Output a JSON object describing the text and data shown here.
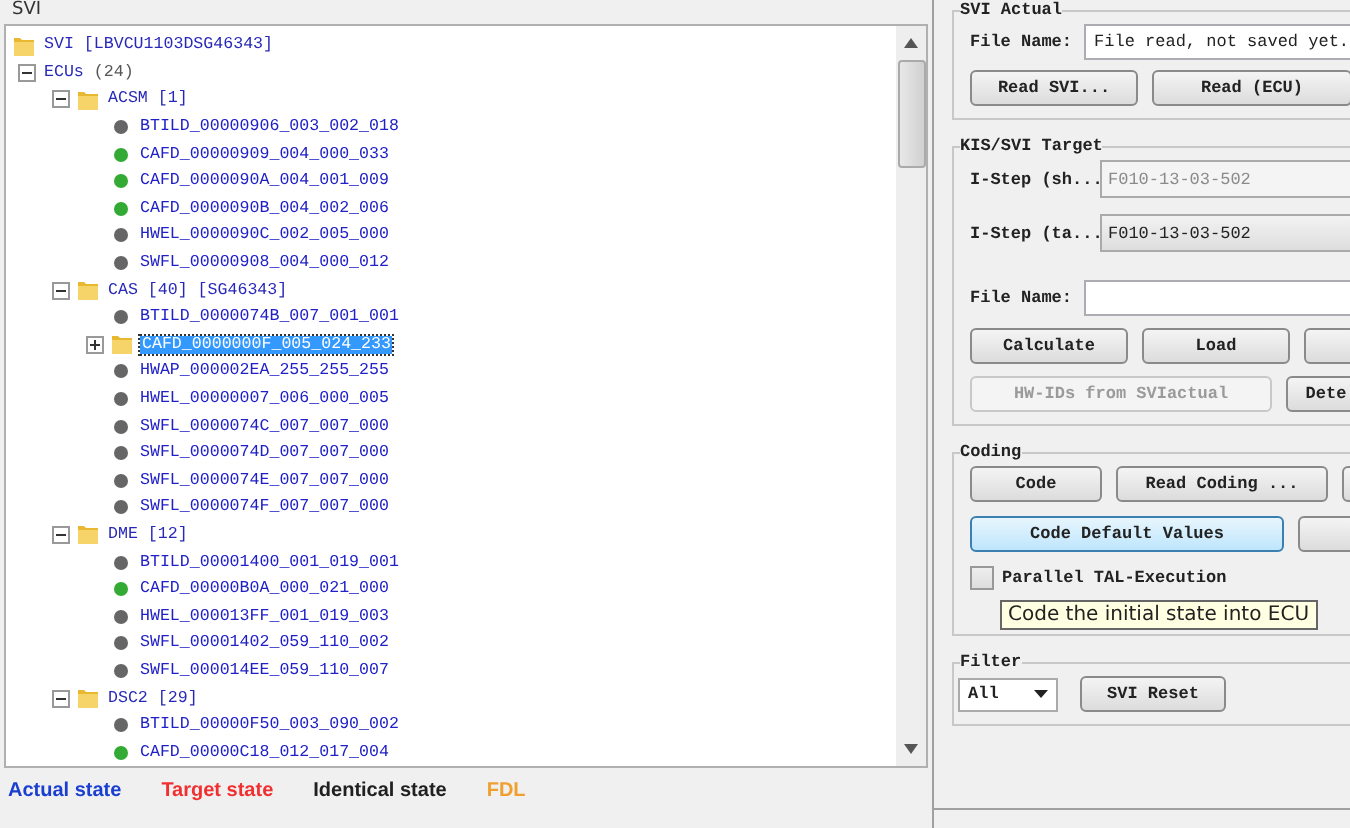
{
  "left_panel": {
    "title": "SVI",
    "tree": {
      "label": "SVI [LBVCU1103DSG46343]",
      "kind": "root",
      "selected": false,
      "children": [
        {
          "label": "ECUs",
          "count": "(24)",
          "kind": "group",
          "expanded": true,
          "selected": false,
          "children": [
            {
              "label": "ACSM [1]",
              "kind": "folder",
              "expanded": true,
              "selected": false,
              "children": [
                {
                  "label": "BTILD_00000906_003_002_018",
                  "kind": "unit",
                  "color": "#666666",
                  "selected": false
                },
                {
                  "label": "CAFD_00000909_004_000_033",
                  "kind": "unit",
                  "color": "#33aa33",
                  "selected": false
                },
                {
                  "label": "CAFD_0000090A_004_001_009",
                  "kind": "unit",
                  "color": "#33aa33",
                  "selected": false
                },
                {
                  "label": "CAFD_0000090B_004_002_006",
                  "kind": "unit",
                  "color": "#33aa33",
                  "selected": false
                },
                {
                  "label": "HWEL_0000090C_002_005_000",
                  "kind": "unit",
                  "color": "#666666",
                  "selected": false
                },
                {
                  "label": "SWFL_00000908_004_000_012",
                  "kind": "unit",
                  "color": "#666666",
                  "selected": false
                }
              ]
            },
            {
              "label": "CAS [40] [SG46343]",
              "kind": "folder",
              "expanded": true,
              "selected": false,
              "children": [
                {
                  "label": "BTILD_0000074B_007_001_001",
                  "kind": "unit",
                  "color": "#666666",
                  "selected": false
                },
                {
                  "label": "CAFD_0000000F_005_024_233",
                  "kind": "folder",
                  "expanded": false,
                  "selected": true
                },
                {
                  "label": "HWAP_000002EA_255_255_255",
                  "kind": "unit",
                  "color": "#666666",
                  "selected": false
                },
                {
                  "label": "HWEL_00000007_006_000_005",
                  "kind": "unit",
                  "color": "#666666",
                  "selected": false
                },
                {
                  "label": "SWFL_0000074C_007_007_000",
                  "kind": "unit",
                  "color": "#666666",
                  "selected": false
                },
                {
                  "label": "SWFL_0000074D_007_007_000",
                  "kind": "unit",
                  "color": "#666666",
                  "selected": false
                },
                {
                  "label": "SWFL_0000074E_007_007_000",
                  "kind": "unit",
                  "color": "#666666",
                  "selected": false
                },
                {
                  "label": "SWFL_0000074F_007_007_000",
                  "kind": "unit",
                  "color": "#666666",
                  "selected": false
                }
              ]
            },
            {
              "label": "DME [12]",
              "kind": "folder",
              "expanded": true,
              "selected": false,
              "children": [
                {
                  "label": "BTILD_00001400_001_019_001",
                  "kind": "unit",
                  "color": "#666666",
                  "selected": false
                },
                {
                  "label": "CAFD_00000B0A_000_021_000",
                  "kind": "unit",
                  "color": "#33aa33",
                  "selected": false
                },
                {
                  "label": "HWEL_000013FF_001_019_003",
                  "kind": "unit",
                  "color": "#666666",
                  "selected": false
                },
                {
                  "label": "SWFL_00001402_059_110_002",
                  "kind": "unit",
                  "color": "#666666",
                  "selected": false
                },
                {
                  "label": "SWFL_000014EE_059_110_007",
                  "kind": "unit",
                  "color": "#666666",
                  "selected": false
                }
              ]
            },
            {
              "label": "DSC2 [29]",
              "kind": "folder",
              "expanded": true,
              "selected": false,
              "children": [
                {
                  "label": "BTILD_00000F50_003_090_002",
                  "kind": "unit",
                  "color": "#666666",
                  "selected": false
                },
                {
                  "label": "CAFD_00000C18_012_017_004",
                  "kind": "unit",
                  "color": "#33aa33",
                  "selected": false
                }
              ]
            }
          ]
        }
      ]
    },
    "legend": [
      {
        "label": "Actual state",
        "color": "#1a3fd0"
      },
      {
        "label": "Target state",
        "color": "#f03030"
      },
      {
        "label": "Identical state",
        "color": "#202020"
      },
      {
        "label": "FDL",
        "color": "#f0a030"
      }
    ]
  },
  "svi_actual": {
    "title": "SVI Actual",
    "file_label": "File Name:",
    "file_value": "File read, not saved yet.",
    "buttons": [
      {
        "label": "Read SVI...",
        "disabled": false
      },
      {
        "label": "Read (ECU)",
        "disabled": false
      }
    ]
  },
  "target": {
    "title": "KIS/SVI Target",
    "steps": [
      {
        "label": "I-Step (sh...",
        "value": "F010-13-03-502",
        "disabled": true
      },
      {
        "label": "I-Step (ta...",
        "value": "F010-13-03-502",
        "disabled": false
      }
    ],
    "file_label": "File Name:",
    "button_rows": [
      [
        {
          "label": "Calculate",
          "disabled": false
        },
        {
          "label": "Load",
          "disabled": false
        },
        {
          "disabled": false
        }
      ],
      [
        {
          "label": "HW-IDs from SVIactual",
          "disabled": true
        },
        {
          "label": "Dete",
          "disabled": false
        }
      ]
    ]
  },
  "coding": {
    "title": "Coding",
    "button_rows": [
      [
        {
          "label": "Code",
          "selected": false
        },
        {
          "label": "Read Coding ...",
          "selected": false
        },
        {
          "selected": false
        }
      ],
      [
        {
          "label": "Code Default Values",
          "selected": true
        },
        {
          "selected": false
        }
      ]
    ],
    "checkbox": {
      "label": "Parallel TAL-Execution",
      "checked": false
    },
    "tooltip": "Code the initial state into ECU"
  },
  "filter": {
    "title": "Filter",
    "value": "All",
    "button": "SVI Reset"
  }
}
